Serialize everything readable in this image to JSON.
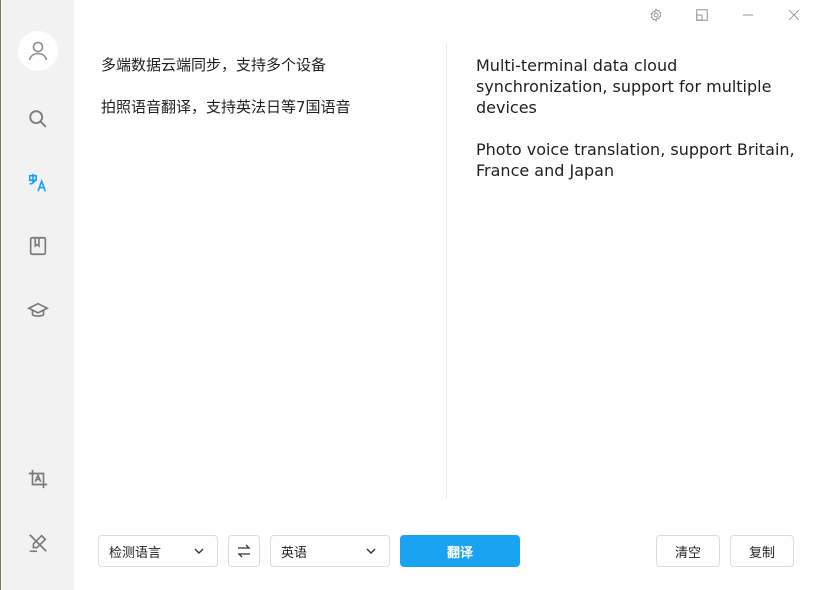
{
  "sidebar": {
    "items": [
      {
        "name": "avatar",
        "icon": "user-icon"
      },
      {
        "name": "search",
        "icon": "search-icon"
      },
      {
        "name": "translate",
        "icon": "translate-icon",
        "active": true
      },
      {
        "name": "notebook",
        "icon": "book-icon"
      },
      {
        "name": "learn",
        "icon": "graduation-cap-icon"
      },
      {
        "name": "screenshot-translate",
        "icon": "crop-text-icon"
      },
      {
        "name": "mouse-translate",
        "icon": "pen-off-icon"
      }
    ],
    "active_color": "#1aa3f0"
  },
  "titlebar": {
    "icons": [
      "gear-icon",
      "restore-icon",
      "minimize-icon",
      "close-icon"
    ]
  },
  "source": {
    "lines": [
      "多端数据云端同步，支持多个设备",
      "拍照语音翻译，支持英法日等7国语音"
    ]
  },
  "target": {
    "lines": [
      "Multi-terminal data cloud synchronization, support for multiple devices",
      "Photo voice translation, support Britain, France and Japan"
    ]
  },
  "toolbar": {
    "source_lang": "检测语言",
    "target_lang": "英语",
    "translate_label": "翻译",
    "clear_label": "清空",
    "copy_label": "复制",
    "accent": "#1aa3f0"
  }
}
